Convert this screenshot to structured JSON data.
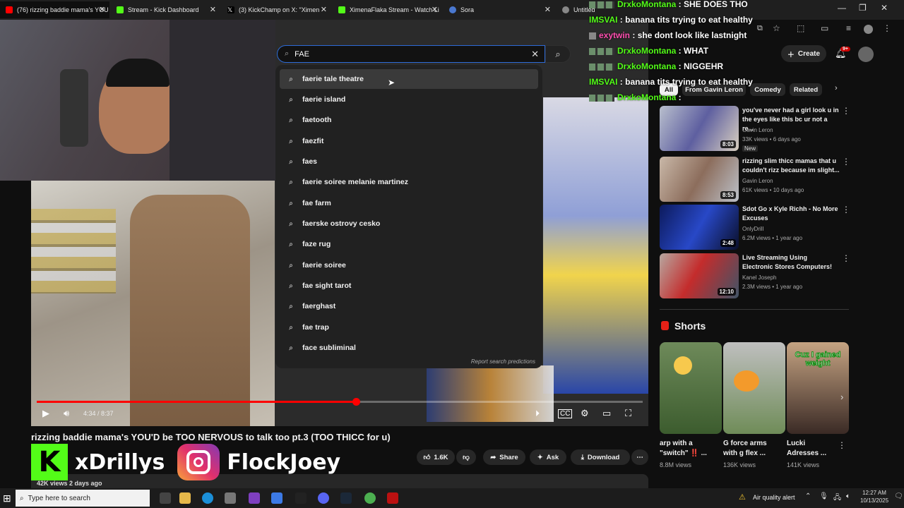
{
  "tabs": [
    {
      "title": "(76) rizzing baddie mama's YOU",
      "color": "#ff0000"
    },
    {
      "title": "Stream - Kick Dashboard",
      "color": "#53fc18"
    },
    {
      "title": "(3) KickChamp on X: \"Ximen",
      "color": "#ffffff"
    },
    {
      "title": "XimenaFlaka Stream - Watch Li",
      "color": "#53fc18"
    },
    {
      "title": "Sora",
      "color": "#4a78d0"
    },
    {
      "title": "Untitled",
      "color": "#888888"
    }
  ],
  "search": {
    "value": "FAE",
    "report": "Report search predictions"
  },
  "suggestions": [
    "faerie tale theatre",
    "faerie island",
    "faetooth",
    "faezfit",
    "faes",
    "faerie soiree melanie martinez",
    "fae farm",
    "faerske ostrovy cesko",
    "faze rug",
    "faerie soiree",
    "fae sight tarot",
    "faerghast",
    "fae trap",
    "face subliminal"
  ],
  "header": {
    "create": "Create",
    "notif_count": "9+"
  },
  "chat": [
    {
      "user": "DrxkoMontana",
      "msg": "SHE DOES THO",
      "color": "#53fc18"
    },
    {
      "user": "IMSVAI",
      "msg": "banana tits trying to eat healthy",
      "color": "#53fc18"
    },
    {
      "user": "exytwin",
      "msg": "she dont look like lastnight",
      "color": "#ff4fb1"
    },
    {
      "user": "DrxkoMontana",
      "msg": "WHAT",
      "color": "#53fc18"
    },
    {
      "user": "DrxkoMontana",
      "msg": "NIGGEHR",
      "color": "#53fc18"
    },
    {
      "user": "IMSVAI",
      "msg": "banana tits trying to eat healthy",
      "color": "#53fc18"
    },
    {
      "user": "DrxkoMontana",
      "msg": "",
      "color": "#53fc18"
    }
  ],
  "player": {
    "time": "4:34 / 8:37",
    "progress": 0.527
  },
  "video": {
    "title": "rizzing baddie mama's YOU'D be TOO NERVOUS to talk too pt.3 (TOO THICC for u)",
    "likes": "1.6K",
    "share": "Share",
    "ask": "Ask",
    "download": "Download",
    "meta": "42K views  2 days ago"
  },
  "overlay": {
    "kick_name": "xDrillys",
    "ig_name": "FlockJoey",
    "kick_letter": "K"
  },
  "chips": [
    "All",
    "From Gavin Leron",
    "Comedy",
    "Related"
  ],
  "recommended": [
    {
      "title": "you've never had a girl look u in the eyes like this bc ur not a re...",
      "channel": "Gavin Leron",
      "stats": "33K views • 6 days ago",
      "duration": "8:03",
      "badge": "New"
    },
    {
      "title": "rizzing slim thicc mamas that u couldn't rizz because im slight...",
      "channel": "Gavin Leron",
      "stats": "61K views • 10 days ago",
      "duration": "8:53",
      "badge": ""
    },
    {
      "title": "Sdot Go x Kyle Richh - No More Excuses",
      "channel": "OnlyDrill",
      "stats": "6.2M views • 1 year ago",
      "duration": "2:48",
      "badge": ""
    },
    {
      "title": "Live Streaming Using Electronic Stores Computers!",
      "channel": "Kanel Joseph",
      "stats": "2.3M views • 1 year ago",
      "duration": "12:10",
      "badge": ""
    }
  ],
  "shorts": {
    "heading": "Shorts",
    "items": [
      {
        "title": "arp with a \"switch\" ‼️ ...",
        "views": "8.8M views"
      },
      {
        "title": "G force arms with g flex ...",
        "views": "136K views"
      },
      {
        "title": "Lucki Adresses ...",
        "views": "141K views",
        "caption": "Cuz I gained weight"
      }
    ]
  },
  "taskbar": {
    "search_placeholder": "Type here to search",
    "air": "Air quality alert",
    "time": "12:27 AM",
    "date": "10/13/2025"
  }
}
